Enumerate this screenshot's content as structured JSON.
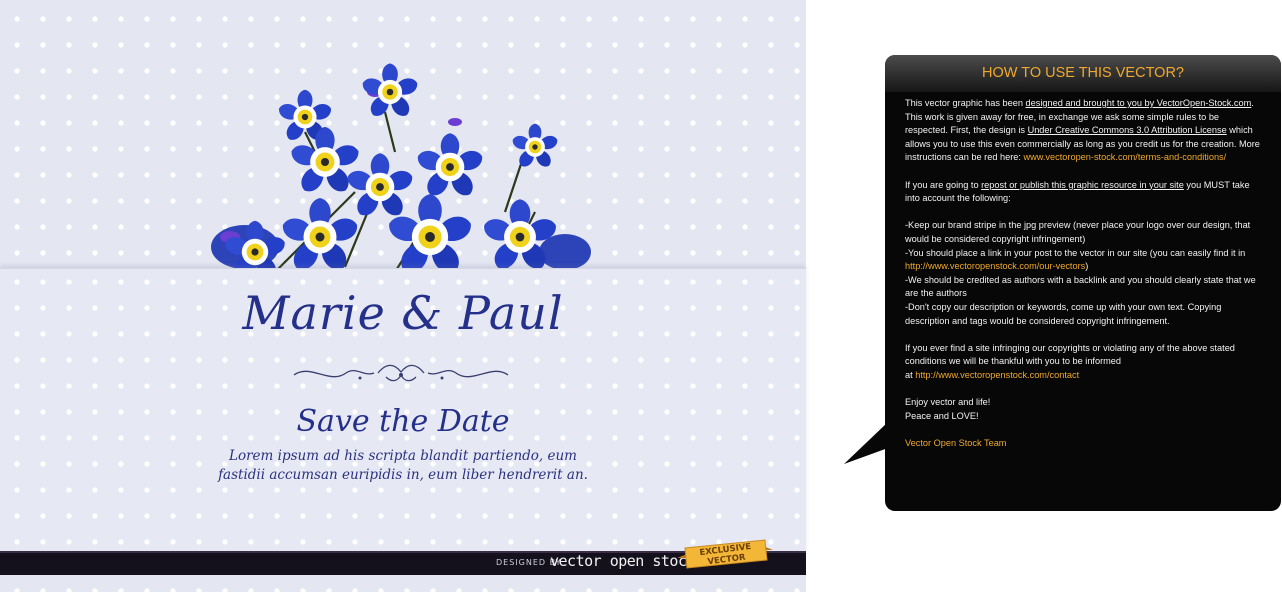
{
  "card": {
    "names": "Marie & Paul",
    "title": "Save the Date",
    "body_line1": "Lorem ipsum ad his scripta blandit partiendo, eum",
    "body_line2": "fastidii accumsan euripidis in, eum liber hendrerit an.",
    "colors": {
      "text": "#24308a",
      "background": "#e4e6f2",
      "flower": "#2540c8"
    }
  },
  "branding": {
    "designed_by": "DESIGNED BY",
    "logo": "vector open stock",
    "ribbon": "EXCLUSIVE VECTOR"
  },
  "info_box": {
    "title": "HOW TO USE THIS VECTOR?",
    "p1_a": "This vector graphic has been ",
    "p1_link1": "designed and brought to you by VectorOpen-Stock.com",
    "p1_b": ". This work is given away for free, in exchange we ask some simple rules to be respected. First, the design is ",
    "p1_link2": "Under Creative Commons 3.0 Attribution License",
    "p1_c": " which allows you to use this even commercially as long as you credit us for the creation. More instructions can be red here: ",
    "p1_url": "www.vectoropen-stock.com/terms-and-conditions/",
    "p2_a": "If you are going to ",
    "p2_link": "repost or publish this graphic resource in your site",
    "p2_b": " you MUST take into account the following:",
    "rule1": "-Keep our brand stripe in the jpg preview (never place your logo over our design, that would be considered copyright infringement)",
    "rule2": "-You should place a link in your post to the vector in our site (you can easily find it in ",
    "rule2_url": "http://www.vectoropenstock.com/our-vectors",
    "rule2_end": ")",
    "rule3": "-We should be credited as authors with a backlink and you should clearly state that we are the authors",
    "rule4": "-Don't copy our description or keywords, come up with your own text. Copying description and tags would be considered copyright infringement.",
    "p4_a": "If you ever find a site infringing our copyrights or violating any of the above stated conditions we will be thankful with you to be informed",
    "p4_b": "at ",
    "p4_url": "http://www.vectoropenstock.com/contact",
    "closing1": "Enjoy vector and life!",
    "closing2": "Peace and LOVE!",
    "signature": "Vector Open Stock Team",
    "colors": {
      "accent": "#f0a92c",
      "background": "#070707"
    }
  }
}
